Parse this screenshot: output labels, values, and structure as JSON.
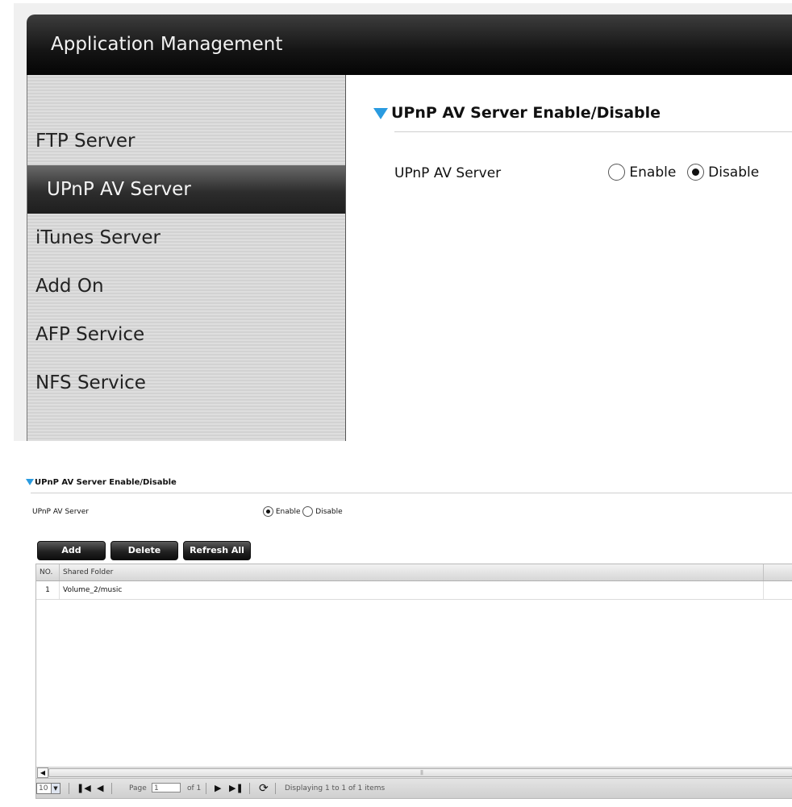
{
  "header": {
    "title": "Application Management"
  },
  "sidebar": {
    "items": [
      {
        "label": "FTP Server",
        "active": false
      },
      {
        "label": "UPnP AV Server",
        "active": true
      },
      {
        "label": "iTunes Server",
        "active": false
      },
      {
        "label": "Add On",
        "active": false
      },
      {
        "label": "AFP Service",
        "active": false
      },
      {
        "label": "NFS Service",
        "active": false
      }
    ]
  },
  "section_top": {
    "title": "UPnP AV Server Enable/Disable",
    "row_label": "UPnP AV Server",
    "enable_label": "Enable",
    "disable_label": "Disable",
    "selected": "Disable"
  },
  "section_bottom": {
    "title": "UPnP AV Server Enable/Disable",
    "row_label": "UPnP AV Server",
    "enable_label": "Enable",
    "disable_label": "Disable",
    "selected": "Enable"
  },
  "toolbar": {
    "add_label": "Add",
    "delete_label": "Delete",
    "refresh_label": "Refresh All"
  },
  "grid": {
    "columns": [
      "NO.",
      "Shared Folder"
    ],
    "rows": [
      {
        "no": "1",
        "folder": "Volume_2/music"
      }
    ]
  },
  "pager": {
    "per_page": "10",
    "page_label": "Page",
    "page_value": "1",
    "of_label": "of 1",
    "status": "Displaying 1 to 1 of 1 items"
  },
  "colors": {
    "accent": "#2a9be0",
    "header_bg": "#141414",
    "active_item_bg": "#2d2d2d"
  },
  "icons": [
    "triangle-down-icon",
    "first-page-icon",
    "prev-page-icon",
    "next-page-icon",
    "last-page-icon",
    "refresh-icon",
    "chevron-down-icon",
    "chevron-left-icon"
  ]
}
